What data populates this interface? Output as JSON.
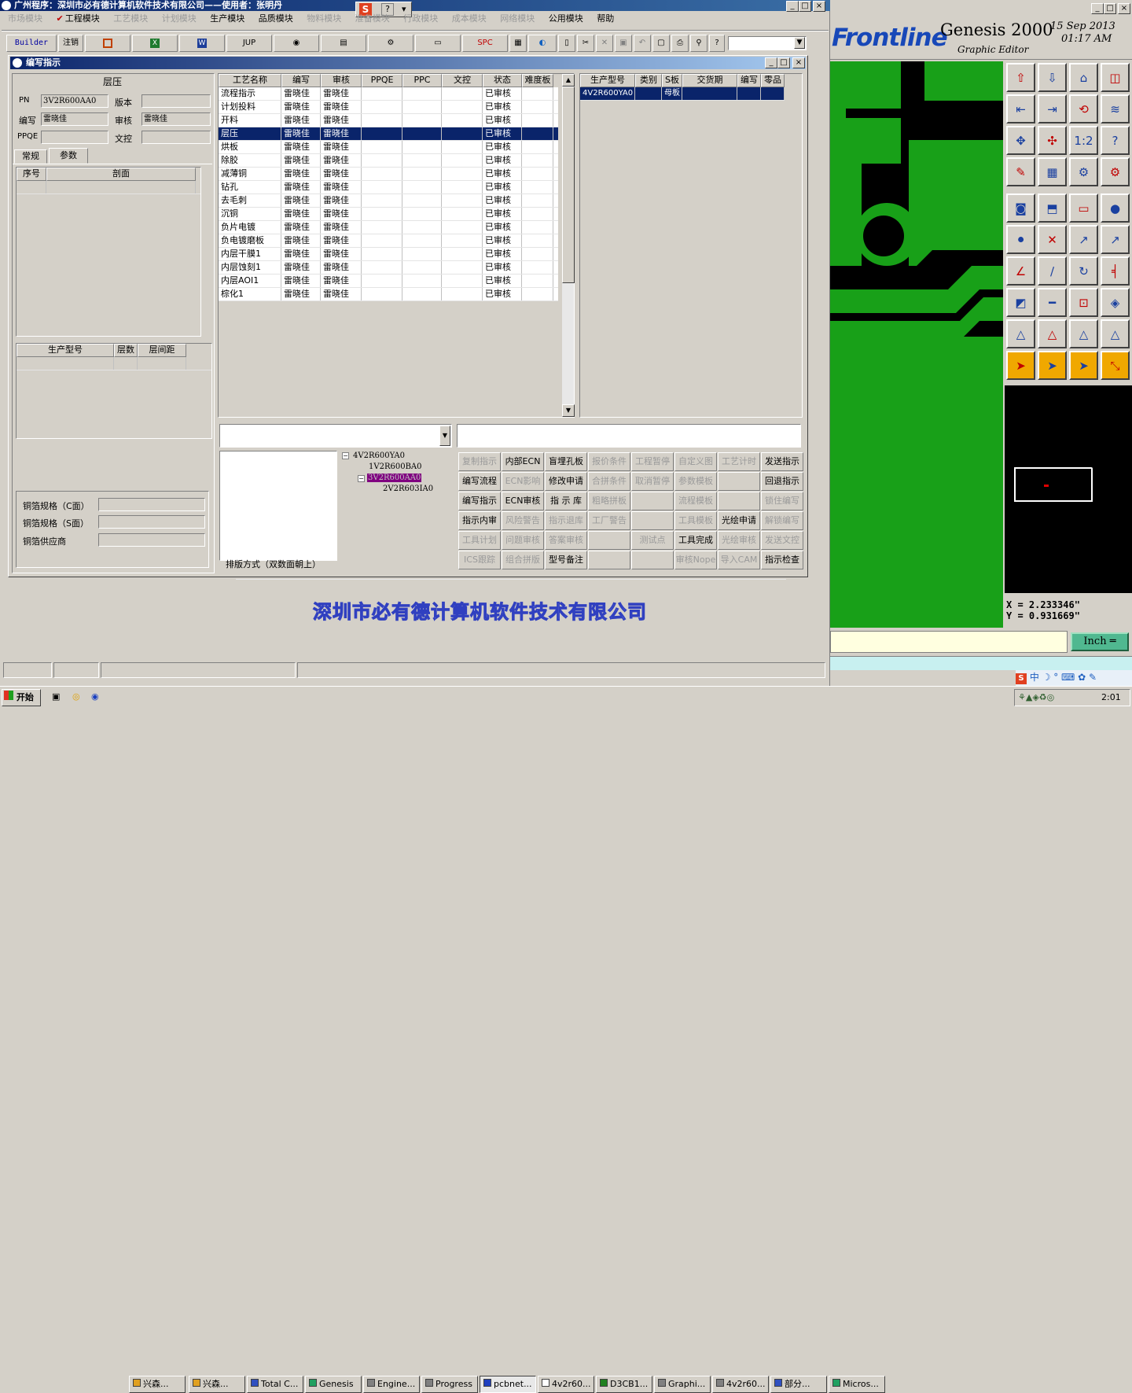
{
  "app": {
    "title": "广州程序：深圳市必有德计算机软件技术有限公司——使用者：张明丹",
    "menu": [
      {
        "label": "市场模块",
        "enabled": false
      },
      {
        "label": "工程模块",
        "enabled": true
      },
      {
        "label": "工艺模块",
        "enabled": false
      },
      {
        "label": "计划模块",
        "enabled": false
      },
      {
        "label": "生产模块",
        "enabled": true
      },
      {
        "label": "品质模块",
        "enabled": true
      },
      {
        "label": "物料模块",
        "enabled": false
      },
      {
        "label": "准备模块",
        "enabled": false
      },
      {
        "label": "行政模块",
        "enabled": false
      },
      {
        "label": "成本模块",
        "enabled": false
      },
      {
        "label": "网络模块",
        "enabled": false
      },
      {
        "label": "公用模块",
        "enabled": true
      },
      {
        "label": "帮助",
        "enabled": true
      }
    ],
    "toolbar": {
      "builder": "Builder",
      "logout": "注销",
      "jup": "JUP",
      "spc": "SPC"
    },
    "watermark": "深圳市必有德计算机软件技术有限公司"
  },
  "dialog": {
    "title": "编写指示",
    "left": {
      "header": "层压",
      "pn_label": "PN",
      "pn": "3V2R600AA0",
      "version_label": "版本",
      "version": "",
      "writer_label": "编写",
      "writer": "雷晓佳",
      "review_label": "审核",
      "reviewer": "雷晓佳",
      "ppqe_label": "PPQE",
      "ppqe": "",
      "text_control_label": "文控",
      "text_control": "",
      "tabs": [
        "常规",
        "参数"
      ],
      "section_cols": [
        "序号",
        "剖面"
      ],
      "model_cols": [
        "生产型号",
        "层数",
        "层间距"
      ],
      "copper_c_label": "铜箔规格（C面）",
      "copper_s_label": "铜箔规格（S面）",
      "copper_supplier_label": "铜箔供应商"
    },
    "process": {
      "columns": [
        "工艺名称",
        "编写",
        "审核",
        "PPQE",
        "PPC",
        "文控",
        "状态",
        "难度板"
      ],
      "rows": [
        [
          "流程指示",
          "雷晓佳",
          "雷晓佳",
          "",
          "",
          "",
          "已审核",
          ""
        ],
        [
          "计划投料",
          "雷晓佳",
          "雷晓佳",
          "",
          "",
          "",
          "已审核",
          ""
        ],
        [
          "开料",
          "雷晓佳",
          "雷晓佳",
          "",
          "",
          "",
          "已审核",
          ""
        ],
        [
          "层压",
          "雷晓佳",
          "雷晓佳",
          "",
          "",
          "",
          "已审核",
          ""
        ],
        [
          "烘板",
          "雷晓佳",
          "雷晓佳",
          "",
          "",
          "",
          "已审核",
          ""
        ],
        [
          "除胶",
          "雷晓佳",
          "雷晓佳",
          "",
          "",
          "",
          "已审核",
          ""
        ],
        [
          "减薄铜",
          "雷晓佳",
          "雷晓佳",
          "",
          "",
          "",
          "已审核",
          ""
        ],
        [
          "钻孔",
          "雷晓佳",
          "雷晓佳",
          "",
          "",
          "",
          "已审核",
          ""
        ],
        [
          "去毛刺",
          "雷晓佳",
          "雷晓佳",
          "",
          "",
          "",
          "已审核",
          ""
        ],
        [
          "沉铜",
          "雷晓佳",
          "雷晓佳",
          "",
          "",
          "",
          "已审核",
          ""
        ],
        [
          "负片电镀",
          "雷晓佳",
          "雷晓佳",
          "",
          "",
          "",
          "已审核",
          ""
        ],
        [
          "负电镀磨板",
          "雷晓佳",
          "雷晓佳",
          "",
          "",
          "",
          "已审核",
          ""
        ],
        [
          "内层干膜1",
          "雷晓佳",
          "雷晓佳",
          "",
          "",
          "",
          "已审核",
          ""
        ],
        [
          "内层蚀刻1",
          "雷晓佳",
          "雷晓佳",
          "",
          "",
          "",
          "已审核",
          ""
        ],
        [
          "内层AOI1",
          "雷晓佳",
          "雷晓佳",
          "",
          "",
          "",
          "已审核",
          ""
        ],
        [
          "棕化1",
          "雷晓佳",
          "雷晓佳",
          "",
          "",
          "",
          "已审核",
          ""
        ]
      ],
      "selected": 3
    },
    "model": {
      "columns": [
        "生产型号",
        "类别",
        "S板",
        "交货期",
        "编写",
        "零品"
      ],
      "rows": [
        [
          "4V2R600YA0",
          "",
          "母板",
          "",
          "",
          ""
        ]
      ]
    },
    "tree": {
      "nodes": [
        "4V2R600YA0",
        "1V2R600BA0",
        "3V2R600AA0",
        "2V2R603IA0"
      ]
    },
    "layout_mode": "排版方式（双数面朝上）",
    "actions": [
      [
        {
          "label": "复制指示",
          "enabled": false
        },
        {
          "label": "内部ECN",
          "enabled": true
        },
        {
          "label": "盲埋孔板",
          "enabled": true
        },
        {
          "label": "报价条件",
          "enabled": false
        },
        {
          "label": "工程暂停",
          "enabled": false
        },
        {
          "label": "自定义图",
          "enabled": false
        },
        {
          "label": "工艺计时",
          "enabled": false
        },
        {
          "label": "发送指示",
          "enabled": true
        }
      ],
      [
        {
          "label": "编写流程",
          "enabled": true
        },
        {
          "label": "ECN影响",
          "enabled": false
        },
        {
          "label": "修改申请",
          "enabled": true
        },
        {
          "label": "合拼条件",
          "enabled": false
        },
        {
          "label": "取消暂停",
          "enabled": false
        },
        {
          "label": "参数模板",
          "enabled": false
        },
        {
          "label": "",
          "enabled": false
        },
        {
          "label": "回退指示",
          "enabled": true
        }
      ],
      [
        {
          "label": "编写指示",
          "enabled": true
        },
        {
          "label": "ECN审核",
          "enabled": true
        },
        {
          "label": "指 示 库",
          "enabled": true
        },
        {
          "label": "粗略拼板",
          "enabled": false
        },
        {
          "label": "",
          "enabled": false
        },
        {
          "label": "流程模板",
          "enabled": false
        },
        {
          "label": "",
          "enabled": false
        },
        {
          "label": "锁住编写",
          "enabled": false
        }
      ],
      [
        {
          "label": "指示内审",
          "enabled": true
        },
        {
          "label": "风险警告",
          "enabled": false
        },
        {
          "label": "指示退库",
          "enabled": false
        },
        {
          "label": "工厂警告",
          "enabled": false
        },
        {
          "label": "",
          "enabled": false
        },
        {
          "label": "工具模板",
          "enabled": false
        },
        {
          "label": "光绘申请",
          "enabled": true
        },
        {
          "label": "解锁编写",
          "enabled": false
        }
      ],
      [
        {
          "label": "工具计划",
          "enabled": false
        },
        {
          "label": "问题审核",
          "enabled": false
        },
        {
          "label": "答案审核",
          "enabled": false
        },
        {
          "label": "",
          "enabled": false
        },
        {
          "label": "测试点",
          "enabled": false
        },
        {
          "label": "工具完成",
          "enabled": true
        },
        {
          "label": "光绘审核",
          "enabled": false
        },
        {
          "label": "发送文控",
          "enabled": false
        }
      ],
      [
        {
          "label": "ICS跟踪",
          "enabled": false
        },
        {
          "label": "组合拼版",
          "enabled": false
        },
        {
          "label": "型号备注",
          "enabled": true
        },
        {
          "label": "",
          "enabled": false
        },
        {
          "label": "",
          "enabled": false
        },
        {
          "label": "审核Nope",
          "enabled": false
        },
        {
          "label": "导入CAM",
          "enabled": false
        },
        {
          "label": "指示检查",
          "enabled": true
        }
      ]
    ]
  },
  "genesis": {
    "brand": "Frontline",
    "product": "Genesis 2000",
    "subtitle": "Graphic Editor",
    "date": "15 Sep 2013",
    "time": "01:17 AM",
    "x": "X = 2.233346\"",
    "y": "Y = 0.931669\"",
    "unit": "Inch"
  },
  "taskbar": {
    "start": "开始",
    "items": [
      "兴森...",
      "兴森...",
      "Total C...",
      "Genesis",
      "Engine...",
      "Progress",
      "pcbnet...",
      "4v2r60...",
      "D3CB1...",
      "Graphi...",
      "4v2r60...",
      "部分...",
      "Micros..."
    ],
    "clock": "2:01"
  }
}
